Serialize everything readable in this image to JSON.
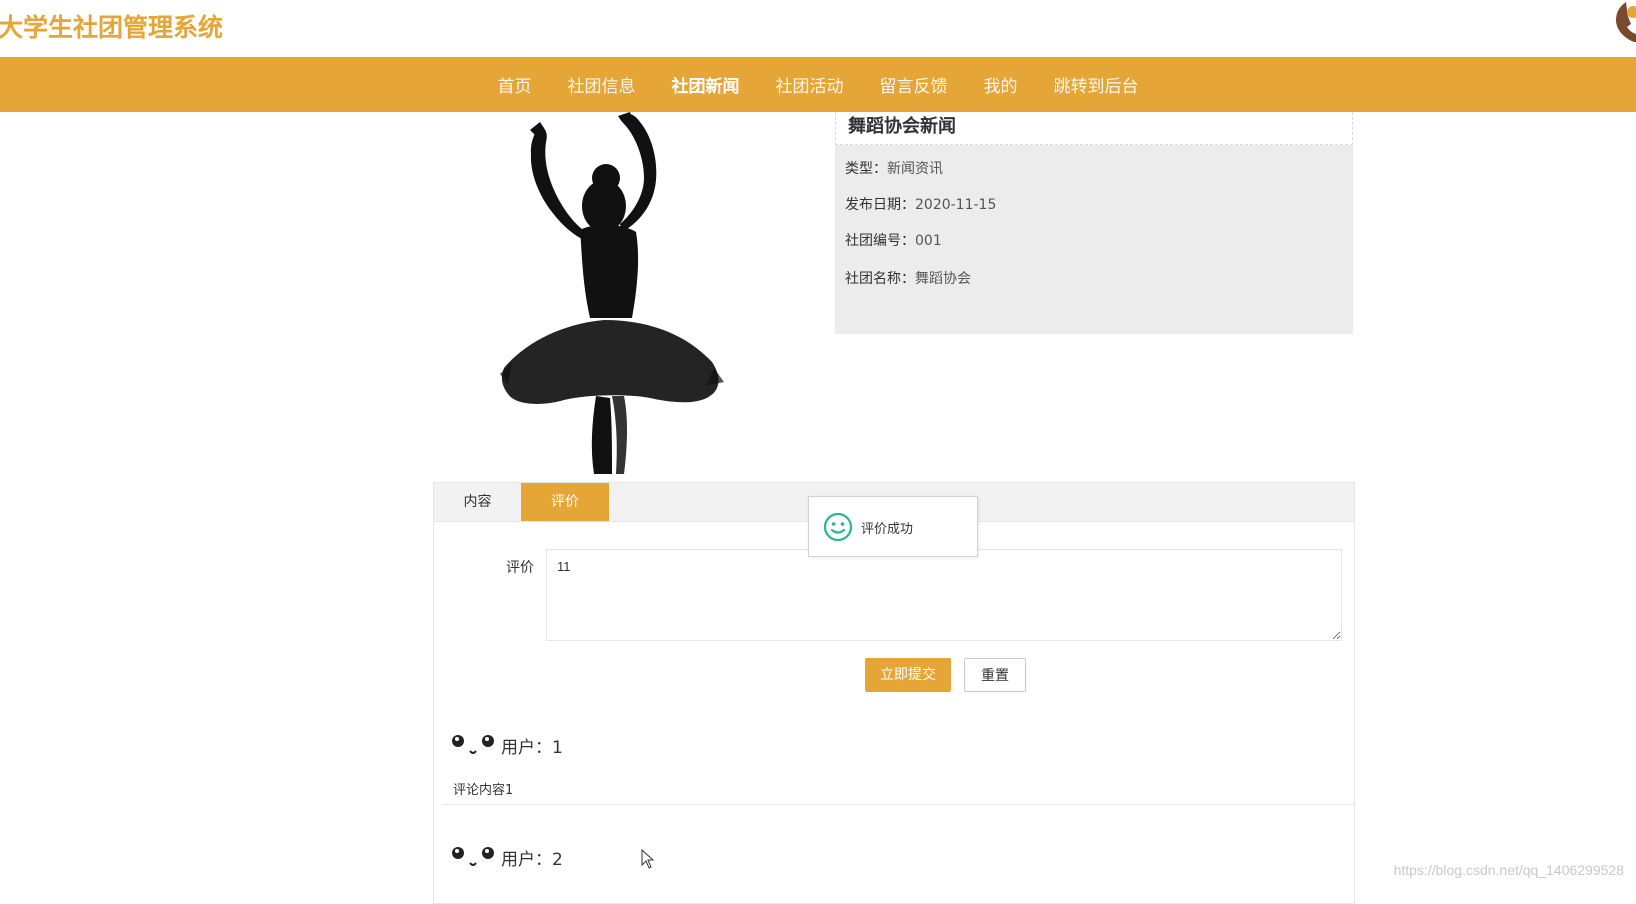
{
  "header": {
    "site_title": "大学生社团管理系统",
    "phone_icon": "phone-icon"
  },
  "nav": {
    "items": [
      {
        "label": "首页",
        "active": false
      },
      {
        "label": "社团信息",
        "active": false
      },
      {
        "label": "社团新闻",
        "active": true
      },
      {
        "label": "社团活动",
        "active": false
      },
      {
        "label": "留言反馈",
        "active": false
      },
      {
        "label": "我的",
        "active": false
      },
      {
        "label": "跳转到后台",
        "active": false
      }
    ]
  },
  "news": {
    "title": "舞蹈协会新闻",
    "fields": [
      {
        "label": "类型：",
        "value": "新闻资讯"
      },
      {
        "label": "发布日期：",
        "value": "2020-11-15"
      },
      {
        "label": "社团编号：",
        "value": "001"
      },
      {
        "label": "社团名称：",
        "value": "舞蹈协会"
      }
    ]
  },
  "tabs": [
    {
      "label": "内容",
      "active": false
    },
    {
      "label": "评价",
      "active": true
    }
  ],
  "review_form": {
    "label": "评价",
    "value": "11",
    "submit_label": "立即提交",
    "reset_label": "重置"
  },
  "comments": [
    {
      "user": "用户：1",
      "content": "评论内容1"
    },
    {
      "user": "用户：2",
      "content": ""
    }
  ],
  "toast": {
    "message": "评价成功",
    "icon": "smile-icon"
  },
  "watermark": "https://blog.csdn.net/qq_1406299528",
  "colors": {
    "accent": "#e5a537",
    "panel_bg": "#ececec",
    "tab_bar_bg": "#f2f2f2",
    "toast_icon": "#2fb58c"
  }
}
